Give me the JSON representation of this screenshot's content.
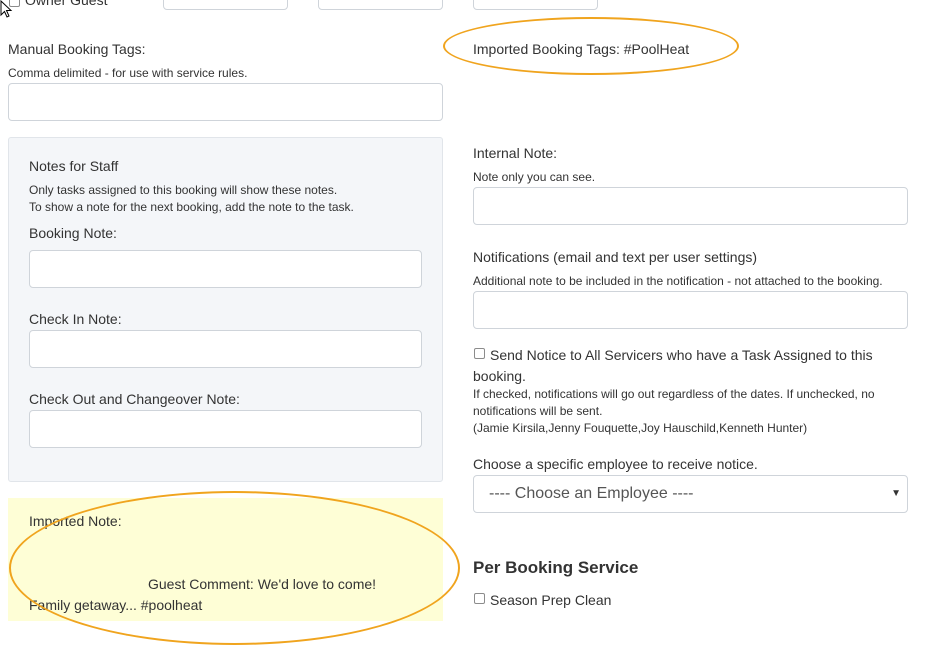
{
  "top": {
    "owner_guest_label": "Owner Guest"
  },
  "manual_tags": {
    "label": "Manual Booking Tags:",
    "help": "Comma delimited - for use with service rules.",
    "value": ""
  },
  "imported_tags": {
    "label": "Imported Booking Tags: #PoolHeat"
  },
  "staff_notes": {
    "title": "Notes for Staff",
    "help_line1": "Only tasks assigned to this booking will show these notes.",
    "help_line2": "To show a note for the next booking, add the note to the task.",
    "booking_note_label": "Booking Note:",
    "check_in_label": "Check In Note:",
    "check_out_label": "Check Out and Changeover Note:"
  },
  "imported_note": {
    "label": "Imported Note:",
    "line1": "Guest Comment: We'd love to come!",
    "line2": "Family getaway... #poolheat"
  },
  "internal_note": {
    "label": "Internal Note:",
    "help": "Note only you can see."
  },
  "notifications": {
    "label": "Notifications (email and text per user settings)",
    "help": "Additional note to be included in the notification - not attached to the booking.",
    "send_notice_line1": "Send Notice to All Servicers who have a Task Assigned to this",
    "send_notice_line2": "booking.",
    "send_notice_help_line1": "If checked, notifications will go out regardless of the dates. If unchecked, no",
    "send_notice_help_line2": "notifications will be sent.",
    "servicers": "(Jamie Kirsila,Jenny Fouquette,Joy Hauschild,Kenneth Hunter)"
  },
  "employee_select": {
    "label": "Choose a specific employee to receive notice.",
    "selected": "---- Choose an Employee ----"
  },
  "per_booking": {
    "title": "Per Booking Service",
    "season_prep_label": "Season Prep Clean"
  },
  "colors": {
    "highlight_ring": "#f0a41e",
    "panel_bg": "#f4f6f9",
    "imported_bg": "#fefed6"
  }
}
